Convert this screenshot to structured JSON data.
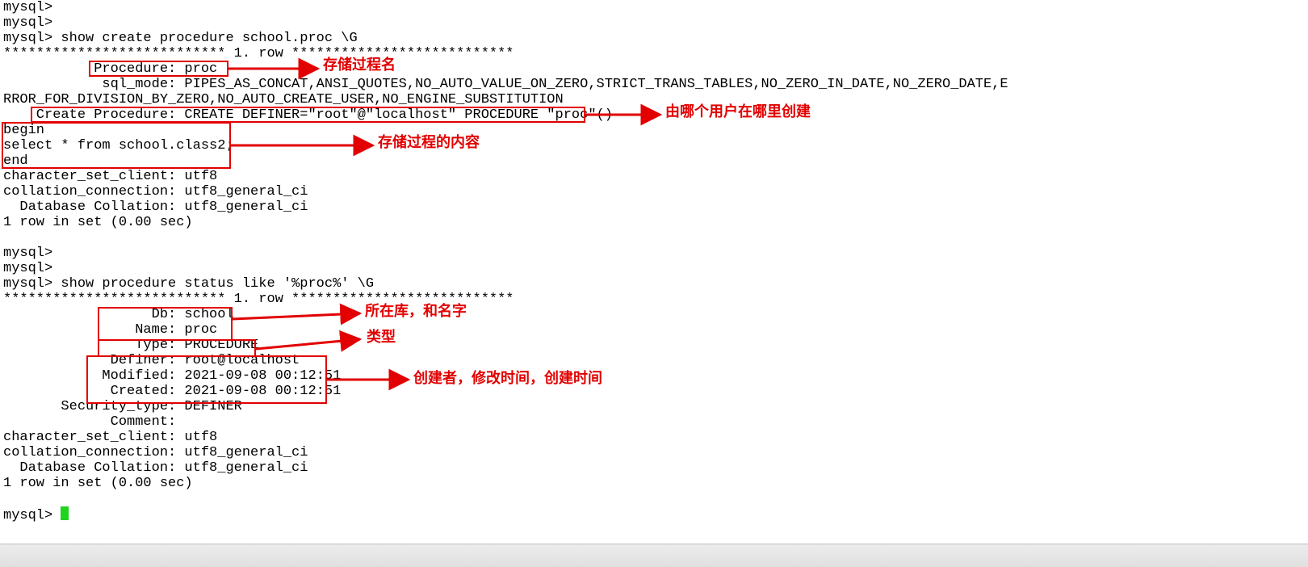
{
  "terminal": {
    "lines": [
      "mysql>",
      "mysql>",
      "mysql> show create procedure school.proc \\G",
      "*************************** 1. row ***************************",
      "           Procedure: proc",
      "            sql_mode: PIPES_AS_CONCAT,ANSI_QUOTES,NO_AUTO_VALUE_ON_ZERO,STRICT_TRANS_TABLES,NO_ZERO_IN_DATE,NO_ZERO_DATE,E",
      "RROR_FOR_DIVISION_BY_ZERO,NO_AUTO_CREATE_USER,NO_ENGINE_SUBSTITUTION",
      "    Create Procedure: CREATE DEFINER=\"root\"@\"localhost\" PROCEDURE \"proc\"()",
      "begin",
      "select * from school.class2;",
      "end",
      "character_set_client: utf8",
      "collation_connection: utf8_general_ci",
      "  Database Collation: utf8_general_ci",
      "1 row in set (0.00 sec)",
      "",
      "mysql>",
      "mysql>",
      "mysql> show procedure status like '%proc%' \\G",
      "*************************** 1. row ***************************",
      "                  Db: school",
      "                Name: proc",
      "                Type: PROCEDURE",
      "             Definer: root@localhost",
      "            Modified: 2021-09-08 00:12:51",
      "             Created: 2021-09-08 00:12:51",
      "       Security_type: DEFINER",
      "             Comment:",
      "character_set_client: utf8",
      "collation_connection: utf8_general_ci",
      "  Database Collation: utf8_general_ci",
      "1 row in set (0.00 sec)",
      "",
      "mysql> "
    ]
  },
  "annotations": {
    "a1": "存储过程名",
    "a2": "由哪个用户在哪里创建",
    "a3": "存储过程的内容",
    "a4": "所在库，和名字",
    "a5": "类型",
    "a6": "创建者，修改时间，创建时间"
  }
}
